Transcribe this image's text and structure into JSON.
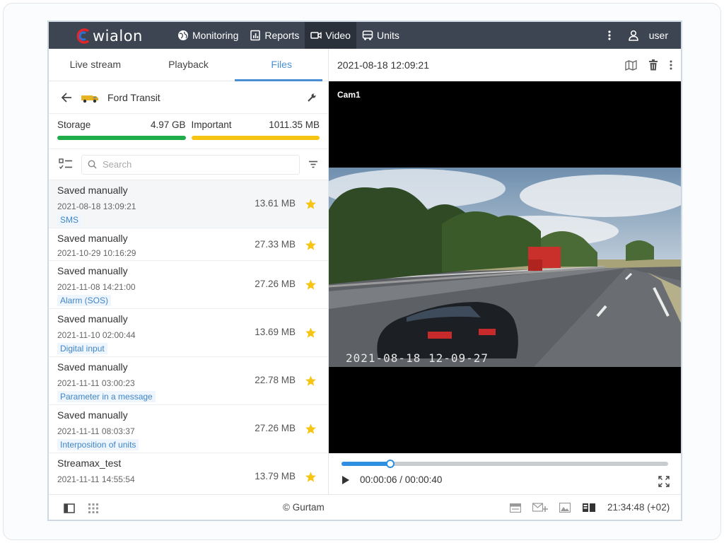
{
  "app": {
    "logo_text": "wialon",
    "nav": [
      {
        "label": "Monitoring",
        "icon": "globe-icon"
      },
      {
        "label": "Reports",
        "icon": "report-icon"
      },
      {
        "label": "Video",
        "icon": "video-icon"
      },
      {
        "label": "Units",
        "icon": "bus-icon"
      }
    ],
    "user": "user"
  },
  "left": {
    "tabs": [
      "Live stream",
      "Playback",
      "Files"
    ],
    "active_tab": "Files",
    "unit_name": "Ford Transit",
    "storage": {
      "label": "Storage",
      "value": "4.97 GB",
      "color": "#1fad4a"
    },
    "important": {
      "label": "Important",
      "value": "1011.35 MB",
      "color": "#f6c514"
    },
    "search_placeholder": "Search",
    "files": [
      {
        "title": "Saved manually",
        "time": "2021-08-18 13:09:21",
        "tag": "SMS",
        "size": "13.61 MB"
      },
      {
        "title": "Saved manually",
        "time": "2021-10-29 10:16:29",
        "tag": "",
        "size": "27.33 MB"
      },
      {
        "title": "Saved manually",
        "time": "2021-11-08 14:21:00",
        "tag": "Alarm (SOS)",
        "size": "27.26 MB"
      },
      {
        "title": "Saved manually",
        "time": "2021-11-10 02:00:44",
        "tag": "Digital input",
        "size": "13.69 MB"
      },
      {
        "title": "Saved manually",
        "time": "2021-11-11 03:00:23",
        "tag": "Parameter in a message",
        "size": "22.78 MB"
      },
      {
        "title": "Saved manually",
        "time": "2021-11-11 08:03:37",
        "tag": "Interposition of units",
        "size": "27.26 MB"
      },
      {
        "title": "Streamax_test",
        "time": "2021-11-11 14:55:54",
        "tag": "",
        "size": "13.79 MB"
      }
    ]
  },
  "right": {
    "datetime": "2021-08-18 12:09:21",
    "camera": "Cam1",
    "video_stamp": "2021-08-18 12-09-27",
    "time_display": "00:00:06 / 00:00:40",
    "progress": 0.15
  },
  "footer": {
    "copyright": "© Gurtam",
    "clock": "21:34:48 (+02)"
  },
  "colors": {
    "accent": "#4a8fd4",
    "topbar": "#3c4551",
    "star": "#f6c514"
  }
}
